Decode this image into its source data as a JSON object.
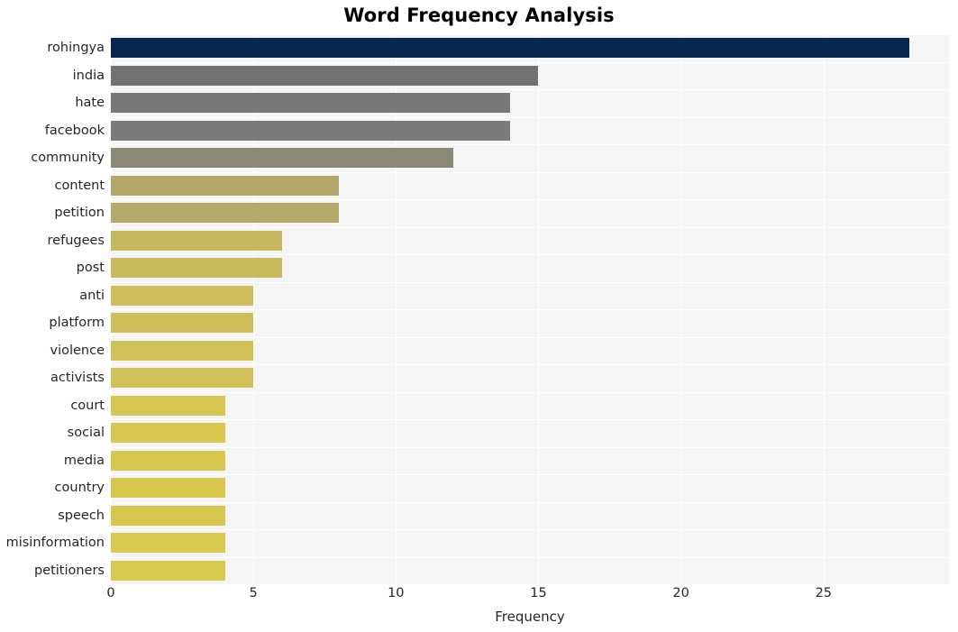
{
  "chart_data": {
    "type": "bar",
    "orientation": "horizontal",
    "title": "Word Frequency Analysis",
    "xlabel": "Frequency",
    "ylabel": "",
    "xlim": [
      0,
      29.4
    ],
    "ylim": null,
    "grid": true,
    "legend": null,
    "xticks": [
      "0",
      "5",
      "10",
      "15",
      "20",
      "25"
    ],
    "xtick_values": [
      0,
      5,
      10,
      15,
      20,
      25
    ],
    "categories": [
      "rohingya",
      "india",
      "hate",
      "facebook",
      "community",
      "content",
      "petition",
      "refugees",
      "post",
      "anti",
      "platform",
      "violence",
      "activists",
      "court",
      "social",
      "media",
      "country",
      "speech",
      "misinformation",
      "petitioners"
    ],
    "values": [
      28,
      15,
      14,
      14,
      12,
      8,
      8,
      6,
      6,
      5,
      5,
      5,
      5,
      4,
      4,
      4,
      4,
      4,
      4,
      4
    ],
    "bar_colors": [
      "#052750",
      "#727272",
      "#787878",
      "#7b7b7b",
      "#8b8877",
      "#b2a869",
      "#b3a968",
      "#c6b85e",
      "#c7b95d",
      "#cdbe59",
      "#cdbe59",
      "#cfc057",
      "#cfc057",
      "#d6c551",
      "#d7c650",
      "#d7c650",
      "#d8c74f",
      "#d8c74f",
      "#d9c84e",
      "#d9c84e"
    ],
    "plot_background": "#f5f5f5",
    "grid_color": "#ffffff",
    "figure_background": "#ffffff"
  }
}
